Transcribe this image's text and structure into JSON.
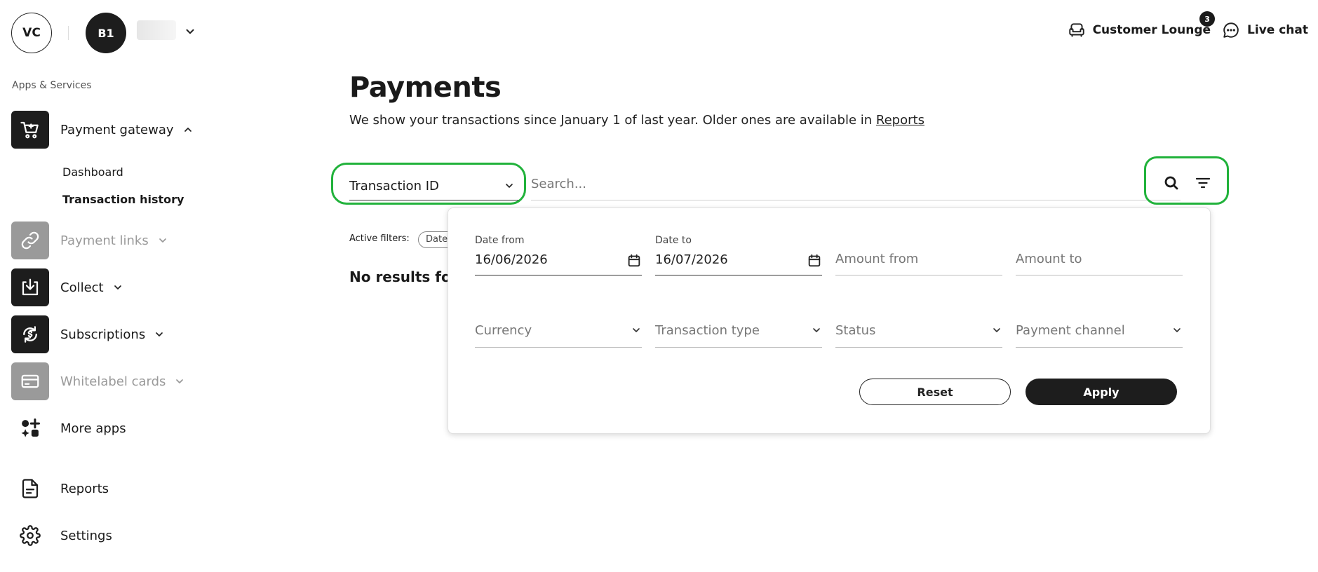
{
  "header": {
    "user_initials": "VC",
    "account_initials": "B1",
    "customer_lounge_label": "Customer Lounge",
    "customer_lounge_badge": "3",
    "live_chat_label": "Live chat"
  },
  "sidebar": {
    "heading": "Apps & Services",
    "items": [
      {
        "label": "Payment gateway",
        "icon": "cart-icon",
        "expanded": true,
        "disabled": false
      },
      {
        "label": "Payment links",
        "icon": "link-icon",
        "expanded": false,
        "disabled": true
      },
      {
        "label": "Collect",
        "icon": "download-tray-icon",
        "expanded": false,
        "disabled": false
      },
      {
        "label": "Subscriptions",
        "icon": "recurring-dollar-icon",
        "expanded": false,
        "disabled": false
      },
      {
        "label": "Whitelabel cards",
        "icon": "card-icon",
        "expanded": false,
        "disabled": true
      }
    ],
    "subitems": [
      {
        "label": "Dashboard",
        "active": false
      },
      {
        "label": "Transaction history",
        "active": true
      }
    ],
    "more_apps_label": "More apps",
    "reports_label": "Reports",
    "settings_label": "Settings"
  },
  "main": {
    "title": "Payments",
    "description": "We show your transactions since January 1 of last year. Older ones are available in ",
    "description_link": "Reports",
    "search_type": "Transaction ID",
    "search_placeholder": "Search...",
    "active_filters_label": "Active filters:",
    "active_filter_chip": "Date",
    "no_results": "No results found"
  },
  "filters": {
    "date_from_label": "Date from",
    "date_from_value": "16/06/2026",
    "date_to_label": "Date to",
    "date_to_value": "16/07/2026",
    "amount_from_placeholder": "Amount from",
    "amount_to_placeholder": "Amount to",
    "currency_placeholder": "Currency",
    "transaction_type_placeholder": "Transaction type",
    "status_placeholder": "Status",
    "payment_channel_placeholder": "Payment channel",
    "reset_label": "Reset",
    "apply_label": "Apply"
  },
  "colors": {
    "highlight": "#21b23b",
    "primary_dark": "#1d1d1d",
    "disabled": "#9a9a9a"
  }
}
